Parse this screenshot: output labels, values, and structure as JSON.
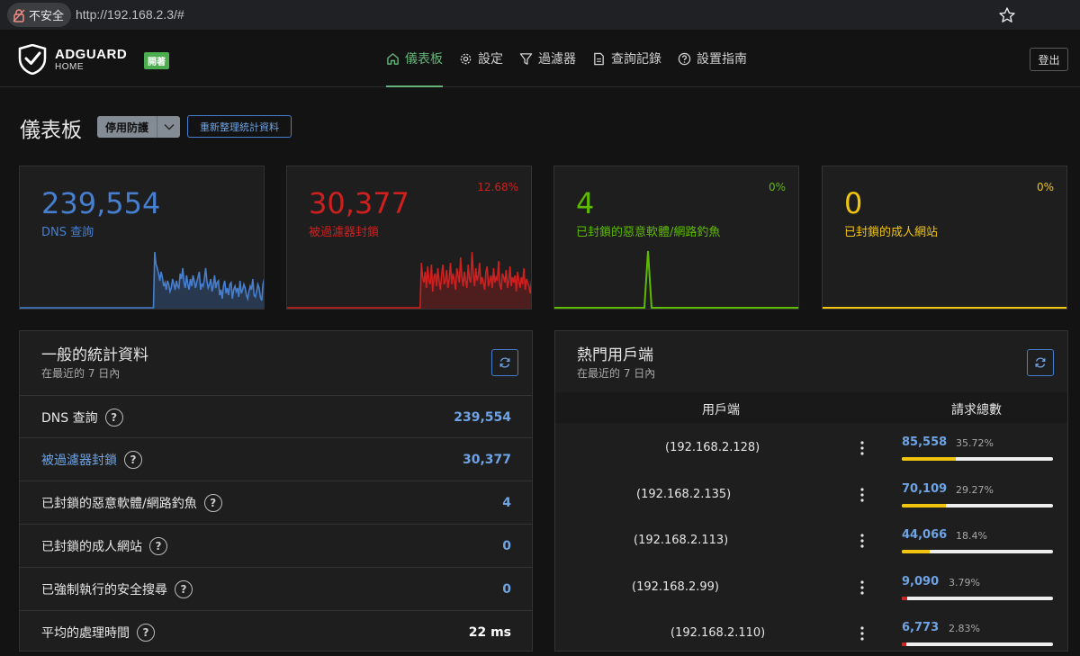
{
  "browser": {
    "security_label": "不安全",
    "url": "http://192.168.2.3/#"
  },
  "header": {
    "logo_title": "ADGUARD",
    "logo_sub": "HOME",
    "badge": "開著",
    "nav": [
      {
        "label": "儀表板",
        "icon": "home-icon",
        "active": true
      },
      {
        "label": "設定",
        "icon": "gear-icon",
        "active": false
      },
      {
        "label": "過濾器",
        "icon": "filter-icon",
        "active": false
      },
      {
        "label": "查詢記錄",
        "icon": "document-icon",
        "active": false
      },
      {
        "label": "設置指南",
        "icon": "help-circle-icon",
        "active": false
      }
    ],
    "logout_label": "登出"
  },
  "page": {
    "title": "儀表板",
    "disable_protection_label": "停用防護",
    "refresh_stats_label": "重新整理統計資料"
  },
  "cards": [
    {
      "value": "239,554",
      "label": "DNS 查詢",
      "percent": "",
      "color": "#467fcf",
      "series": [
        0,
        0,
        0,
        0,
        0,
        0,
        0,
        0,
        0,
        0,
        0,
        0,
        0,
        0,
        0,
        0,
        0,
        0,
        0,
        0,
        0,
        0,
        0,
        0,
        0,
        0,
        0,
        0,
        0,
        0,
        0,
        0,
        0,
        0,
        0,
        0,
        0,
        0,
        0,
        0,
        0,
        0,
        0,
        0,
        0,
        0,
        0,
        0,
        0,
        0,
        0,
        0,
        0,
        0,
        0,
        0,
        0,
        0,
        0,
        0,
        0,
        0,
        0,
        0,
        0,
        0,
        0,
        0,
        0,
        0,
        0,
        0,
        0,
        0,
        0,
        0,
        0,
        0,
        0,
        0,
        0,
        0,
        0,
        0,
        0,
        0,
        0,
        0,
        0,
        0,
        0,
        0,
        0,
        0,
        0,
        0,
        0,
        0,
        0,
        0,
        0,
        0,
        0,
        0,
        0,
        0,
        62,
        48,
        44,
        38,
        30,
        40,
        34,
        24,
        28,
        20,
        30,
        26,
        18,
        22,
        32,
        26,
        20,
        30,
        24,
        22,
        38,
        32,
        44,
        28,
        22,
        36,
        26,
        20,
        32,
        24,
        36,
        30,
        22,
        28,
        34,
        40,
        20,
        26,
        24,
        32,
        44,
        30,
        22,
        26,
        32,
        18,
        24,
        36,
        22,
        28,
        30,
        14,
        20,
        10,
        24,
        30,
        16,
        22,
        14,
        26,
        28,
        10,
        20,
        24,
        18,
        22,
        12,
        30,
        16,
        20,
        26,
        22,
        14,
        10,
        18,
        24,
        20,
        32,
        14,
        12,
        18,
        26,
        22,
        12,
        8,
        26,
        32,
        18
      ]
    },
    {
      "value": "30,377",
      "label": "被過濾器封鎖",
      "percent": "12.68%",
      "color": "#cd201f",
      "series": [
        0,
        0,
        0,
        0,
        0,
        0,
        0,
        0,
        0,
        0,
        0,
        0,
        0,
        0,
        0,
        0,
        0,
        0,
        0,
        0,
        0,
        0,
        0,
        0,
        0,
        0,
        0,
        0,
        0,
        0,
        0,
        0,
        0,
        0,
        0,
        0,
        0,
        0,
        0,
        0,
        0,
        0,
        0,
        0,
        0,
        0,
        0,
        0,
        0,
        0,
        0,
        0,
        0,
        0,
        0,
        0,
        0,
        0,
        0,
        0,
        0,
        0,
        0,
        0,
        0,
        0,
        0,
        0,
        0,
        0,
        0,
        0,
        0,
        0,
        0,
        0,
        0,
        0,
        0,
        0,
        0,
        0,
        0,
        0,
        0,
        0,
        0,
        0,
        0,
        0,
        0,
        0,
        0,
        0,
        0,
        0,
        0,
        0,
        0,
        0,
        0,
        0,
        0,
        0,
        0,
        0,
        50,
        34,
        28,
        40,
        22,
        46,
        30,
        26,
        48,
        18,
        34,
        38,
        24,
        44,
        30,
        20,
        36,
        48,
        26,
        30,
        42,
        22,
        32,
        50,
        26,
        38,
        30,
        20,
        44,
        36,
        28,
        56,
        34,
        24,
        40,
        30,
        22,
        48,
        32,
        28,
        62,
        38,
        24,
        44,
        30,
        36,
        50,
        26,
        34,
        28,
        20,
        40,
        46,
        24,
        30,
        36,
        22,
        44,
        28,
        34,
        30,
        52,
        26,
        20,
        38,
        34,
        28,
        42,
        22,
        30,
        46,
        24,
        34,
        28,
        36,
        18,
        40,
        30,
        22,
        34,
        26,
        44,
        20,
        32,
        28,
        24,
        16,
        30,
        22
      ]
    },
    {
      "value": "4",
      "label": "已封鎖的惡意軟體/網路釣魚",
      "percent": "0%",
      "color": "#5eba00",
      "series": [
        0,
        0,
        0,
        0,
        0,
        0,
        0,
        0,
        0,
        0,
        0,
        0,
        0,
        0,
        0,
        0,
        0,
        0,
        0,
        0,
        0,
        0,
        0,
        0,
        0,
        0,
        0,
        0,
        0,
        0,
        0,
        0,
        0,
        0,
        0,
        0,
        0,
        0,
        0,
        0,
        0,
        0,
        0,
        0,
        0,
        0,
        0,
        0,
        0,
        0,
        0,
        0,
        0,
        0,
        0,
        0,
        0,
        0,
        0,
        0,
        0,
        0,
        0,
        0,
        0,
        0,
        0,
        0,
        0,
        0,
        0,
        0,
        0,
        0,
        0,
        0,
        0,
        0,
        0,
        0,
        0,
        0,
        0,
        0,
        0,
        0,
        0,
        0,
        0,
        0,
        0,
        0,
        0,
        0,
        0,
        0,
        0,
        0,
        0,
        0,
        0,
        0,
        0,
        0,
        0,
        0,
        0,
        0,
        0,
        0,
        0,
        0,
        0,
        0,
        0,
        0,
        0,
        0,
        0,
        0,
        0,
        0,
        0,
        0,
        0,
        0,
        0,
        0,
        0,
        0,
        0,
        0,
        0,
        0,
        0,
        0,
        0,
        0,
        0,
        0,
        0,
        0,
        0,
        0,
        0,
        0,
        0,
        0,
        0,
        0,
        0,
        0,
        0,
        0,
        0,
        0,
        0,
        0,
        0,
        0,
        0,
        0,
        0,
        0,
        0,
        0,
        0,
        0,
        0,
        0,
        0,
        0,
        0,
        0,
        0,
        0,
        0,
        0,
        0,
        0,
        0,
        0,
        0,
        0,
        0,
        0,
        0,
        0,
        0,
        0,
        0,
        0,
        0,
        0,
        0,
        0,
        0,
        0,
        0,
        0,
        0,
        0,
        0,
        0,
        0,
        0,
        0,
        0,
        0,
        0,
        0,
        0,
        0,
        0,
        0,
        0,
        0,
        0,
        0,
        0,
        0,
        0,
        0,
        0,
        0,
        0,
        0,
        0,
        0,
        0,
        0,
        0,
        0,
        0,
        0,
        0,
        0,
        0,
        0,
        0,
        0,
        0,
        0,
        0,
        0,
        0,
        0,
        0,
        0,
        0,
        0,
        0,
        0,
        0,
        0,
        0,
        0
      ]
    },
    {
      "value": "0",
      "label": "已封鎖的成人網站",
      "percent": "0%",
      "color": "#f1c40f",
      "series": []
    }
  ],
  "general_stats": {
    "title": "一般的統計資料",
    "subtitle": "在最近的 7 日內",
    "rows": [
      {
        "label": "DNS 查詢",
        "value": "239,554",
        "label_link": false,
        "value_plain": false
      },
      {
        "label": "被過濾器封鎖",
        "value": "30,377",
        "label_link": true,
        "value_plain": false
      },
      {
        "label": "已封鎖的惡意軟體/網路釣魚",
        "value": "4",
        "label_link": false,
        "value_plain": false
      },
      {
        "label": "已封鎖的成人網站",
        "value": "0",
        "label_link": false,
        "value_plain": false
      },
      {
        "label": "已強制執行的安全搜尋",
        "value": "0",
        "label_link": false,
        "value_plain": false
      },
      {
        "label": "平均的處理時間",
        "value": "22 ms",
        "label_link": false,
        "value_plain": true
      }
    ]
  },
  "top_clients": {
    "title": "熱門用戶端",
    "subtitle": "在最近的 7 日內",
    "col_client": "用戶端",
    "col_requests": "請求總數",
    "rows": [
      {
        "ip": "(192.168.2.128)",
        "count": "85,558",
        "percent": "35.72%",
        "fraction": 0.3572,
        "color": "#f1c40f"
      },
      {
        "ip": "(192.168.2.135)",
        "count": "70,109",
        "percent": "29.27%",
        "fraction": 0.2927,
        "color": "#f1c40f"
      },
      {
        "ip": "(192.168.2.113)",
        "count": "44,066",
        "percent": "18.4%",
        "fraction": 0.184,
        "color": "#f1c40f"
      },
      {
        "ip": "(192.168.2.99)",
        "count": "9,090",
        "percent": "3.79%",
        "fraction": 0.0379,
        "color": "#cd201f"
      },
      {
        "ip": "(192.168.2.110)",
        "count": "6,773",
        "percent": "2.83%",
        "fraction": 0.0283,
        "color": "#cd201f"
      }
    ]
  }
}
